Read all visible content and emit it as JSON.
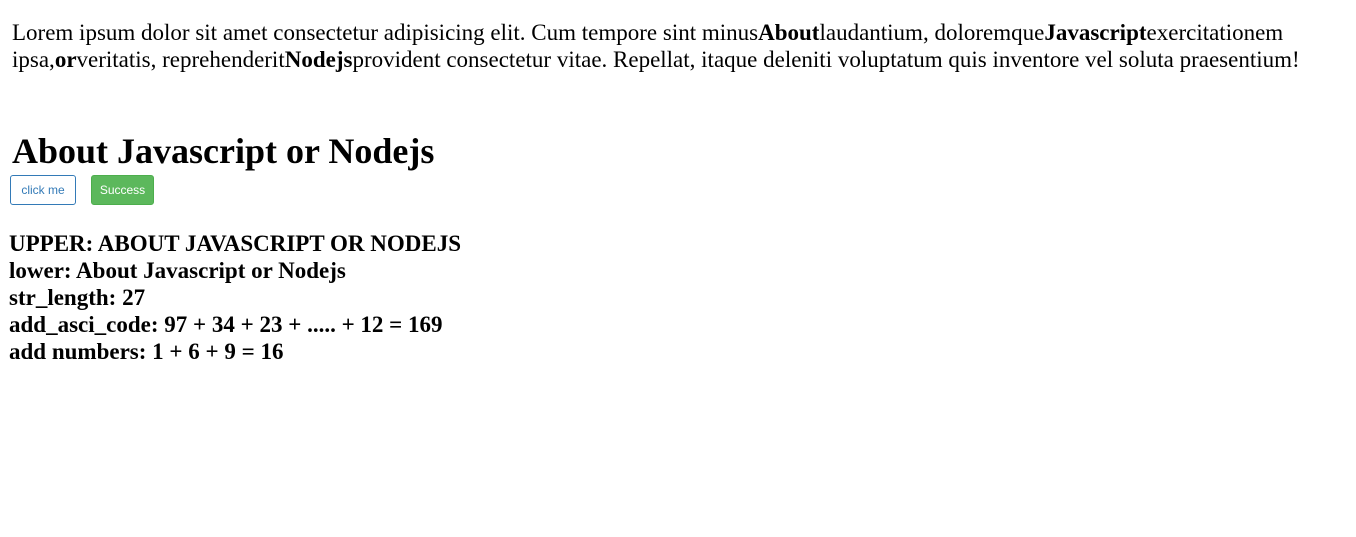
{
  "paragraph": {
    "t1": "Lorem ipsum dolor sit amet consectetur adipisicing elit. Cum tempore sint minus",
    "b1": "About",
    "t2": "laudantium, doloremque",
    "b2": "Javascript",
    "t3": "exercitationem ipsa,",
    "b3": "or",
    "t4": "veritatis, reprehenderit",
    "b4": "Nodejs",
    "t5": "provident consectetur vitae. Repellat, itaque deleniti voluptatum quis inventore vel soluta praesentium!"
  },
  "heading": "About Javascript or Nodejs",
  "buttons": {
    "click_me": "click me",
    "success": "Success"
  },
  "results": {
    "upper": "UPPER: ABOUT JAVASCRIPT OR NODEJS",
    "lower": "lower: About Javascript or Nodejs",
    "str_length": "str_length: 27",
    "add_asci_code": "add_asci_code: 97 + 34 + 23 + ..... + 12 = 169",
    "add_numbers": "add numbers: 1 + 6 + 9 = 16"
  },
  "colors": {
    "outline_button": "#337ab7",
    "success_button": "#5cb85c"
  }
}
